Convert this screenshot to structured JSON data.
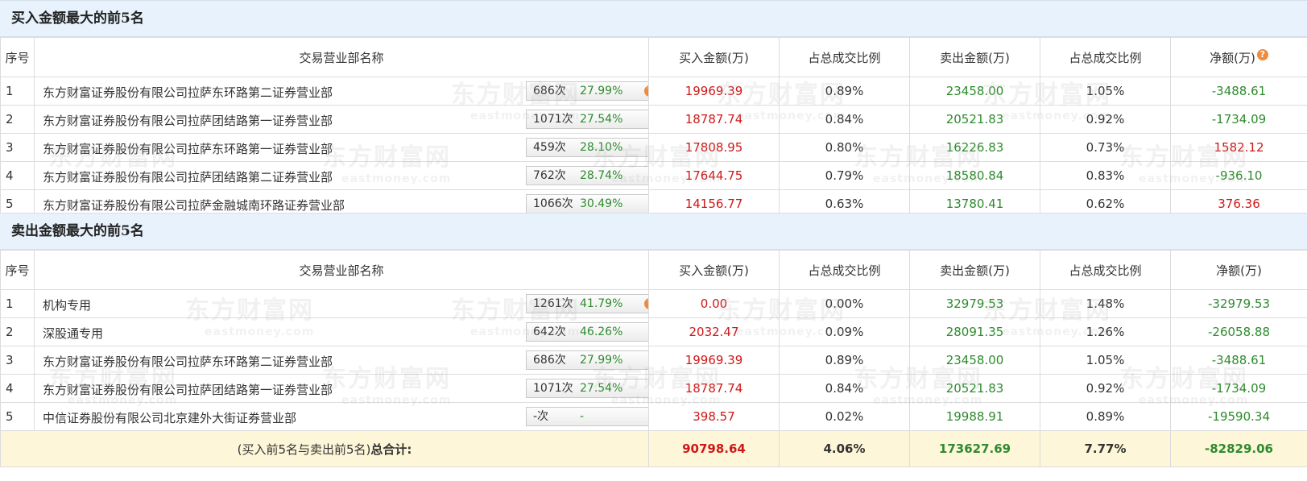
{
  "buy_section": {
    "title": "买入金额最大的前5名",
    "headers": [
      "序号",
      "交易营业部名称",
      "买入金额(万)",
      "占总成交比例",
      "卖出金额(万)",
      "占总成交比例",
      "净额(万)"
    ],
    "rows": [
      {
        "idx": "1",
        "name": "东方财富证券股份有限公司拉萨东环路第二证券营业部",
        "times": "686次",
        "pct": "27.99%",
        "icon": "question-icon",
        "buy": "19969.39",
        "buy_ratio": "0.89%",
        "sell": "23458.00",
        "sell_ratio": "1.05%",
        "net": "-3488.61",
        "net_color": "green"
      },
      {
        "idx": "2",
        "name": "东方财富证券股份有限公司拉萨团结路第一证券营业部",
        "times": "1071次",
        "pct": "27.54%",
        "icon": "arrow-icon",
        "buy": "18787.74",
        "buy_ratio": "0.84%",
        "sell": "20521.83",
        "sell_ratio": "0.92%",
        "net": "-1734.09",
        "net_color": "green"
      },
      {
        "idx": "3",
        "name": "东方财富证券股份有限公司拉萨东环路第一证券营业部",
        "times": "459次",
        "pct": "28.10%",
        "icon": "arrow-icon",
        "buy": "17808.95",
        "buy_ratio": "0.80%",
        "sell": "16226.83",
        "sell_ratio": "0.73%",
        "net": "1582.12",
        "net_color": "red"
      },
      {
        "idx": "4",
        "name": "东方财富证券股份有限公司拉萨团结路第二证券营业部",
        "times": "762次",
        "pct": "28.74%",
        "icon": "arrow-icon",
        "buy": "17644.75",
        "buy_ratio": "0.79%",
        "sell": "18580.84",
        "sell_ratio": "0.83%",
        "net": "-936.10",
        "net_color": "green"
      },
      {
        "idx": "5",
        "name": "东方财富证券股份有限公司拉萨金融城南环路证券营业部",
        "times": "1066次",
        "pct": "30.49%",
        "icon": "arrow-icon",
        "buy": "14156.77",
        "buy_ratio": "0.63%",
        "sell": "13780.41",
        "sell_ratio": "0.62%",
        "net": "376.36",
        "net_color": "red"
      }
    ]
  },
  "sell_section": {
    "title": "卖出金额最大的前5名",
    "headers": [
      "序号",
      "交易营业部名称",
      "买入金额(万)",
      "占总成交比例",
      "卖出金额(万)",
      "占总成交比例",
      "净额(万)"
    ],
    "rows": [
      {
        "idx": "1",
        "name": "机构专用",
        "times": "1261次",
        "pct": "41.79%",
        "icon": "question-icon",
        "buy": "0.00",
        "buy_ratio": "0.00%",
        "sell": "32979.53",
        "sell_ratio": "1.48%",
        "net": "-32979.53",
        "net_color": "green"
      },
      {
        "idx": "2",
        "name": "深股通专用",
        "times": "642次",
        "pct": "46.26%",
        "icon": "arrow-icon",
        "buy": "2032.47",
        "buy_ratio": "0.09%",
        "sell": "28091.35",
        "sell_ratio": "1.26%",
        "net": "-26058.88",
        "net_color": "green"
      },
      {
        "idx": "3",
        "name": "东方财富证券股份有限公司拉萨东环路第二证券营业部",
        "times": "686次",
        "pct": "27.99%",
        "icon": "arrow-icon",
        "buy": "19969.39",
        "buy_ratio": "0.89%",
        "sell": "23458.00",
        "sell_ratio": "1.05%",
        "net": "-3488.61",
        "net_color": "green"
      },
      {
        "idx": "4",
        "name": "东方财富证券股份有限公司拉萨团结路第一证券营业部",
        "times": "1071次",
        "pct": "27.54%",
        "icon": "arrow-icon",
        "buy": "18787.74",
        "buy_ratio": "0.84%",
        "sell": "20521.83",
        "sell_ratio": "0.92%",
        "net": "-1734.09",
        "net_color": "green"
      },
      {
        "idx": "5",
        "name": "中信证券股份有限公司北京建外大街证券营业部",
        "times": "-次",
        "pct": "-",
        "icon": "arrow-icon",
        "buy": "398.57",
        "buy_ratio": "0.02%",
        "sell": "19988.91",
        "sell_ratio": "0.89%",
        "net": "-19590.34",
        "net_color": "green"
      }
    ]
  },
  "total": {
    "label": "(买入前5名与卖出前5名)",
    "label_bold": "总合计:",
    "buy": "90798.64",
    "buy_ratio": "4.06%",
    "sell": "173627.69",
    "sell_ratio": "7.77%",
    "net": "-82829.06"
  },
  "watermark": {
    "cn": "东方财富网",
    "en": "eastmoney.com"
  },
  "colors": {
    "buy_red": "#d01818",
    "sell_green": "#2e8b2e",
    "section_bg": "#e7f2fc",
    "total_bg": "#fdf6d8",
    "question_orange": "#f08a3c",
    "arrow_blue": "#1c5fa8"
  }
}
